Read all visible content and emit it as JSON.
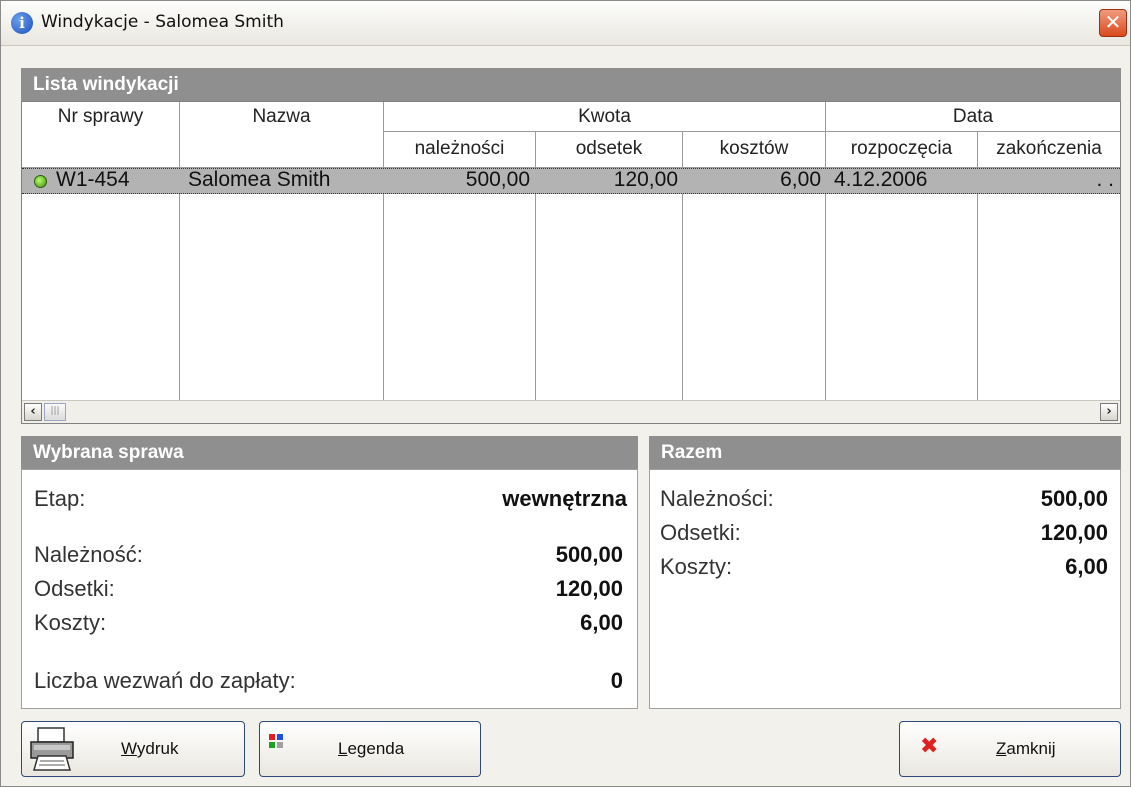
{
  "window": {
    "title": "Windykacje - Salomea Smith"
  },
  "list": {
    "header": "Lista windykacji",
    "columns": {
      "nr": "Nr sprawy",
      "nazwa": "Nazwa",
      "kwota": "Kwota",
      "naleznosci": "należności",
      "odsetek": "odsetek",
      "kosztow": "kosztów",
      "data": "Data",
      "rozpoczecia": "rozpoczęcia",
      "zakonczenia": "zakończenia"
    },
    "rows": [
      {
        "nr": "W1-454",
        "nazwa": "Salomea Smith",
        "naleznosci": "500,00",
        "odsetek": "120,00",
        "kosztow": "6,00",
        "rozpoczecia": "4.12.2006",
        "zakonczenia": ". ."
      }
    ]
  },
  "selected": {
    "header": "Wybrana sprawa",
    "etap_label": "Etap:",
    "etap_value": "wewnętrzna",
    "naleznosc_label": "Należność:",
    "naleznosc_value": "500,00",
    "odsetki_label": "Odsetki:",
    "odsetki_value": "120,00",
    "koszty_label": "Koszty:",
    "koszty_value": "6,00",
    "wezwania_label": "Liczba wezwań do zapłaty:",
    "wezwania_value": "0"
  },
  "total": {
    "header": "Razem",
    "naleznosci_label": "Należności:",
    "naleznosci_value": "500,00",
    "odsetki_label": "Odsetki:",
    "odsetki_value": "120,00",
    "koszty_label": "Koszty:",
    "koszty_value": "6,00"
  },
  "buttons": {
    "wydruk_key": "W",
    "wydruk_rest": "ydruk",
    "legenda_key": "L",
    "legenda_rest": "egenda",
    "zamknij_key": "Z",
    "zamknij_rest": "amknij"
  },
  "icons": {
    "title": "info-icon",
    "close": "close-x-icon",
    "status": "green-status-dot-icon",
    "print": "printer-icon",
    "legend": "color-squares-icon",
    "zamknij": "red-x-icon"
  }
}
